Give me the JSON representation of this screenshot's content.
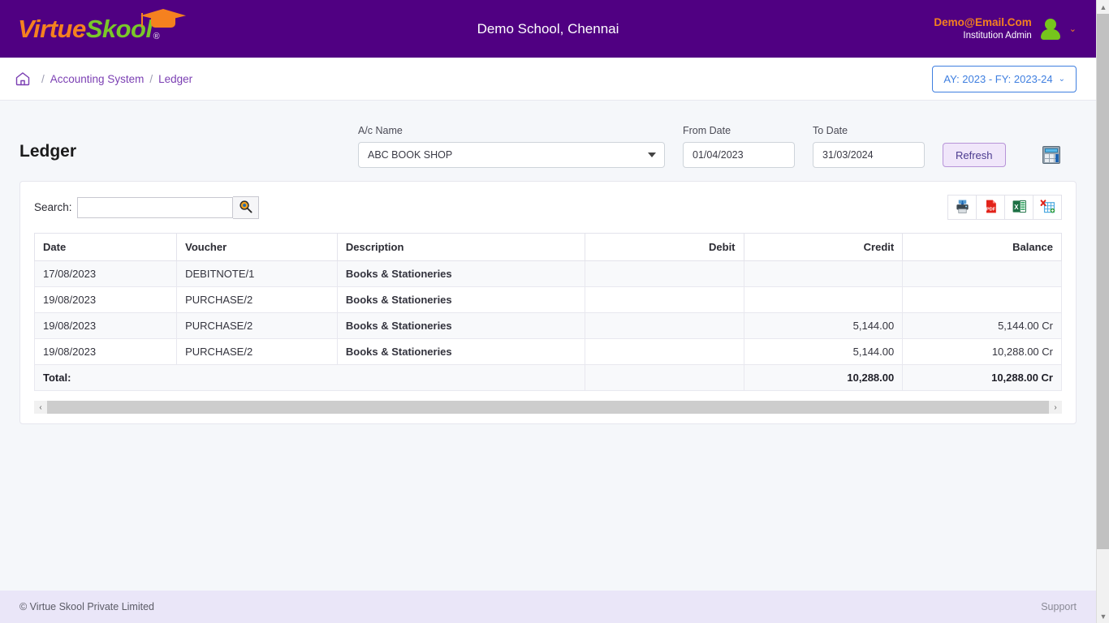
{
  "header": {
    "logo_part1": "Virtue",
    "logo_part2": "Skool",
    "logo_registered": "®",
    "school_title": "Demo School, Chennai",
    "user_email": "Demo@Email.Com",
    "user_role": "Institution Admin",
    "user_caret": "⌄"
  },
  "breadcrumb": {
    "home_icon": "home-icon",
    "sep": "/",
    "item1": "Accounting System",
    "current": "Ledger",
    "ay_label": "AY: 2023 - FY: 2023-24",
    "ay_caret": "⌄"
  },
  "filters": {
    "page_title": "Ledger",
    "ac_name_label": "A/c Name",
    "ac_name_value": "ABC BOOK SHOP",
    "ac_name_options": [
      "ABC BOOK SHOP"
    ],
    "from_date_label": "From Date",
    "from_date_value": "01/04/2023",
    "to_date_label": "To Date",
    "to_date_value": "31/03/2024",
    "refresh_label": "Refresh",
    "calculator_icon": "calculator-icon"
  },
  "toolbar": {
    "search_label": "Search:",
    "search_value": "",
    "search_placeholder": "",
    "search_icon": "magnifier-icon",
    "exports": [
      {
        "name": "print-export-button",
        "icon": "printer-icon"
      },
      {
        "name": "pdf-export-button",
        "icon": "pdf-icon"
      },
      {
        "name": "excel-export-button",
        "icon": "excel-icon"
      },
      {
        "name": "xml-export-button",
        "icon": "xml-table-icon"
      }
    ]
  },
  "table": {
    "columns": [
      {
        "label": "Date",
        "align": "left"
      },
      {
        "label": "Voucher",
        "align": "left"
      },
      {
        "label": "Description",
        "align": "left"
      },
      {
        "label": "Debit",
        "align": "right"
      },
      {
        "label": "Credit",
        "align": "right"
      },
      {
        "label": "Balance",
        "align": "right"
      }
    ],
    "rows": [
      {
        "date": "17/08/2023",
        "voucher": "DEBITNOTE/1",
        "description": "Books & Stationeries",
        "debit": "",
        "credit": "",
        "balance": ""
      },
      {
        "date": "19/08/2023",
        "voucher": "PURCHASE/2",
        "description": "Books & Stationeries",
        "debit": "",
        "credit": "",
        "balance": ""
      },
      {
        "date": "19/08/2023",
        "voucher": "PURCHASE/2",
        "description": "Books & Stationeries",
        "debit": "",
        "credit": "5,144.00",
        "balance": "5,144.00 Cr"
      },
      {
        "date": "19/08/2023",
        "voucher": "PURCHASE/2",
        "description": "Books & Stationeries",
        "debit": "",
        "credit": "5,144.00",
        "balance": "10,288.00 Cr"
      }
    ],
    "total": {
      "label": "Total:",
      "voucher": "",
      "description": "",
      "debit": "",
      "credit": "10,288.00",
      "balance": "10,288.00 Cr"
    },
    "scroll_left_icon": "‹",
    "scroll_right_icon": "›"
  },
  "footer": {
    "copyright": "© Virtue Skool Private Limited",
    "support": "Support"
  },
  "colors": {
    "brand_purple": "#500082",
    "logo_orange": "#f5811f",
    "logo_green": "#7ac829",
    "link_purple": "#7b3fb3",
    "ay_blue": "#3f7fe0",
    "footer_bg": "#eae6f8"
  }
}
